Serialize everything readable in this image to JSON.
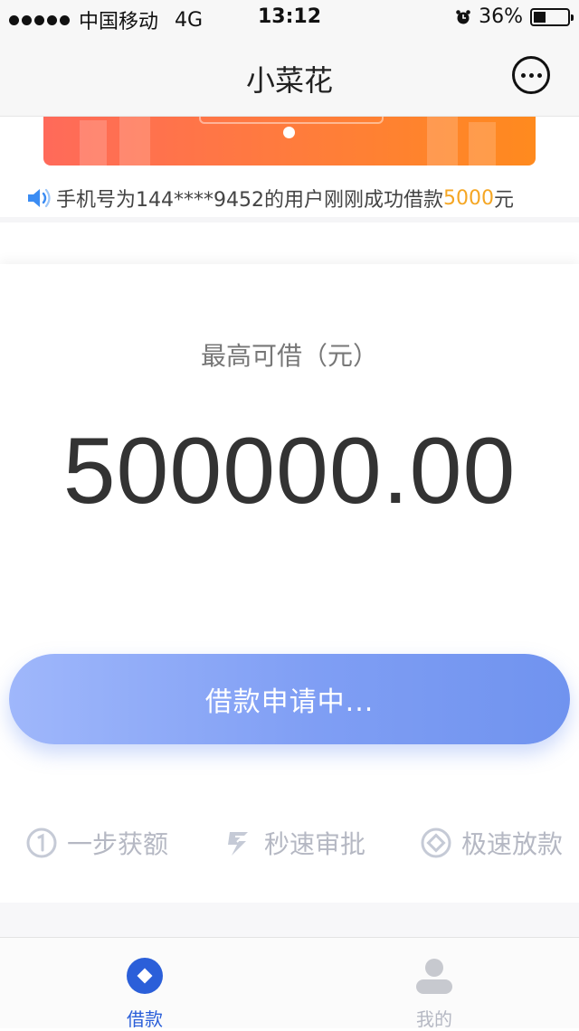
{
  "status_bar": {
    "carrier": "中国移动",
    "network": "4G",
    "time": "13:12",
    "battery_percent": "36%",
    "battery_level": 0.36
  },
  "nav": {
    "title": "小菜花",
    "more_icon": "more-dots-icon"
  },
  "ticker": {
    "prefix": "手机号为144****9452的用户刚刚成功借款",
    "amount": "5000",
    "suffix": "元",
    "icon": "speaker-icon"
  },
  "loan": {
    "label": "最高可借（元）",
    "max_amount": "500000.00",
    "apply_button": "借款申请中..."
  },
  "features": [
    {
      "label": "一步获额",
      "icon": "number-one-icon"
    },
    {
      "label": "秒速审批",
      "icon": "lightning-icon"
    },
    {
      "label": "极速放款",
      "icon": "diamond-icon"
    }
  ],
  "tabs": [
    {
      "label": "借款",
      "icon": "loan-diamond-icon",
      "active": true
    },
    {
      "label": "我的",
      "icon": "user-icon",
      "active": false
    }
  ],
  "colors": {
    "accent": "#2b5fd9",
    "ticker_amount": "#f5a623",
    "button_start": "#9fb7fb",
    "button_end": "#7093ef",
    "banner_start": "#ff6a5a",
    "banner_end": "#ff8a1e",
    "inactive": "#b5b8c3"
  }
}
